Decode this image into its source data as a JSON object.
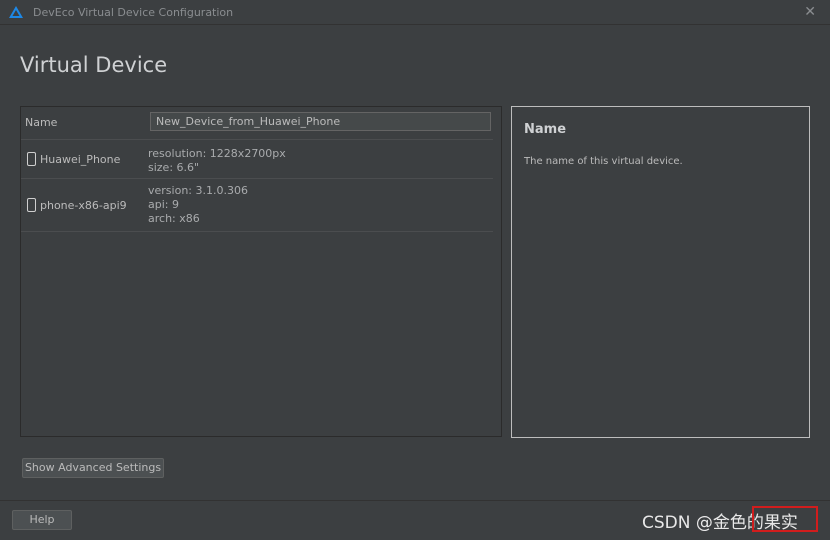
{
  "window": {
    "title": "DevEco Virtual Device Configuration",
    "close_icon": "close-icon",
    "app_icon": "deveco-logo-icon",
    "accent_color": "#1e88e5"
  },
  "page": {
    "heading": "Virtual Device"
  },
  "form": {
    "name_label": "Name",
    "name_value": "New_Device_from_Huawei_Phone"
  },
  "devices": [
    {
      "icon": "phone-icon",
      "name": "Huawei_Phone",
      "specs": [
        "resolution: 1228x2700px",
        "size: 6.6\""
      ]
    },
    {
      "icon": "phone-icon",
      "name": "phone-x86-api9",
      "specs": [
        "version: 3.1.0.306",
        "api: 9",
        "arch: x86"
      ]
    }
  ],
  "help_panel": {
    "title": "Name",
    "description": "The name of this virtual device."
  },
  "buttons": {
    "advanced": "Show Advanced Settings",
    "help": "Help"
  },
  "watermark": {
    "text": "CSDN @金色的果实",
    "highlight_color": "#d11d1d"
  }
}
